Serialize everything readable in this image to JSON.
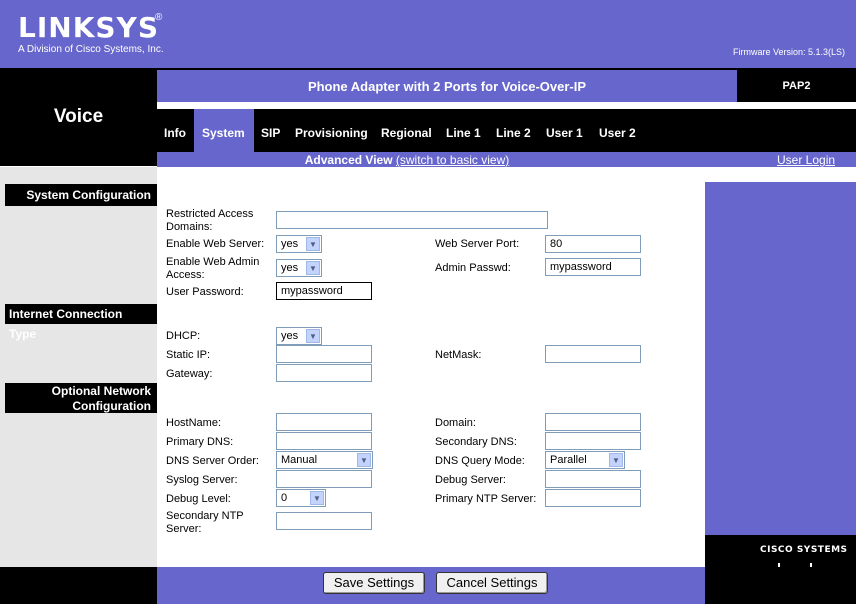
{
  "brand": {
    "logo": "LINKSYS",
    "reg": "®",
    "subtitle": "A Division of Cisco Systems, Inc.",
    "firmware": "Firmware Version: 5.1.3(LS)"
  },
  "section": "Voice",
  "title": "Phone Adapter with 2 Ports for Voice-Over-IP",
  "model": "PAP2",
  "tabs": [
    "Info",
    "System",
    "SIP",
    "Provisioning",
    "Regional",
    "Line 1",
    "Line 2",
    "User 1",
    "User 2"
  ],
  "active_tab": "System",
  "view": {
    "label": "Advanced View",
    "switch": "(switch to basic view)",
    "login": "User Login"
  },
  "sections": {
    "system": "System Configuration",
    "internet": "Internet Connection Type",
    "optional_line1": "Optional Network",
    "optional_line2": "Configuration"
  },
  "fields": {
    "restricted_line1": "Restricted Access",
    "restricted_line2": "Domains:",
    "restricted_value": "",
    "enable_web_server": "Enable Web Server:",
    "enable_web_server_value": "yes",
    "web_server_port": "Web Server Port:",
    "web_server_port_value": "80",
    "enable_admin_line1": "Enable Web Admin",
    "enable_admin_line2": "Access:",
    "enable_admin_value": "yes",
    "admin_passwd": "Admin Passwd:",
    "admin_passwd_value": "mypassword",
    "user_password": "User Password:",
    "user_password_value": "mypassword",
    "dhcp": "DHCP:",
    "dhcp_value": "yes",
    "static_ip": "Static IP:",
    "static_ip_value": "",
    "netmask": "NetMask:",
    "netmask_value": "",
    "gateway": "Gateway:",
    "gateway_value": "",
    "hostname": "HostName:",
    "hostname_value": "",
    "domain": "Domain:",
    "domain_value": "",
    "primary_dns": "Primary DNS:",
    "primary_dns_value": "",
    "secondary_dns": "Secondary DNS:",
    "secondary_dns_value": "",
    "dns_order": "DNS Server Order:",
    "dns_order_value": "Manual",
    "dns_query": "DNS Query Mode:",
    "dns_query_value": "Parallel",
    "syslog": "Syslog Server:",
    "syslog_value": "",
    "debug_server": "Debug Server:",
    "debug_server_value": "",
    "debug_level": "Debug Level:",
    "debug_level_value": "0",
    "primary_ntp": "Primary NTP Server:",
    "primary_ntp_value": "",
    "secondary_ntp_line1": "Secondary NTP",
    "secondary_ntp_line2": "Server:",
    "secondary_ntp_value": ""
  },
  "buttons": {
    "save": "Save Settings",
    "cancel": "Cancel Settings"
  },
  "cisco": "Cisco Systems",
  "colors": {
    "accent": "#6666cc",
    "dark": "#000000"
  }
}
